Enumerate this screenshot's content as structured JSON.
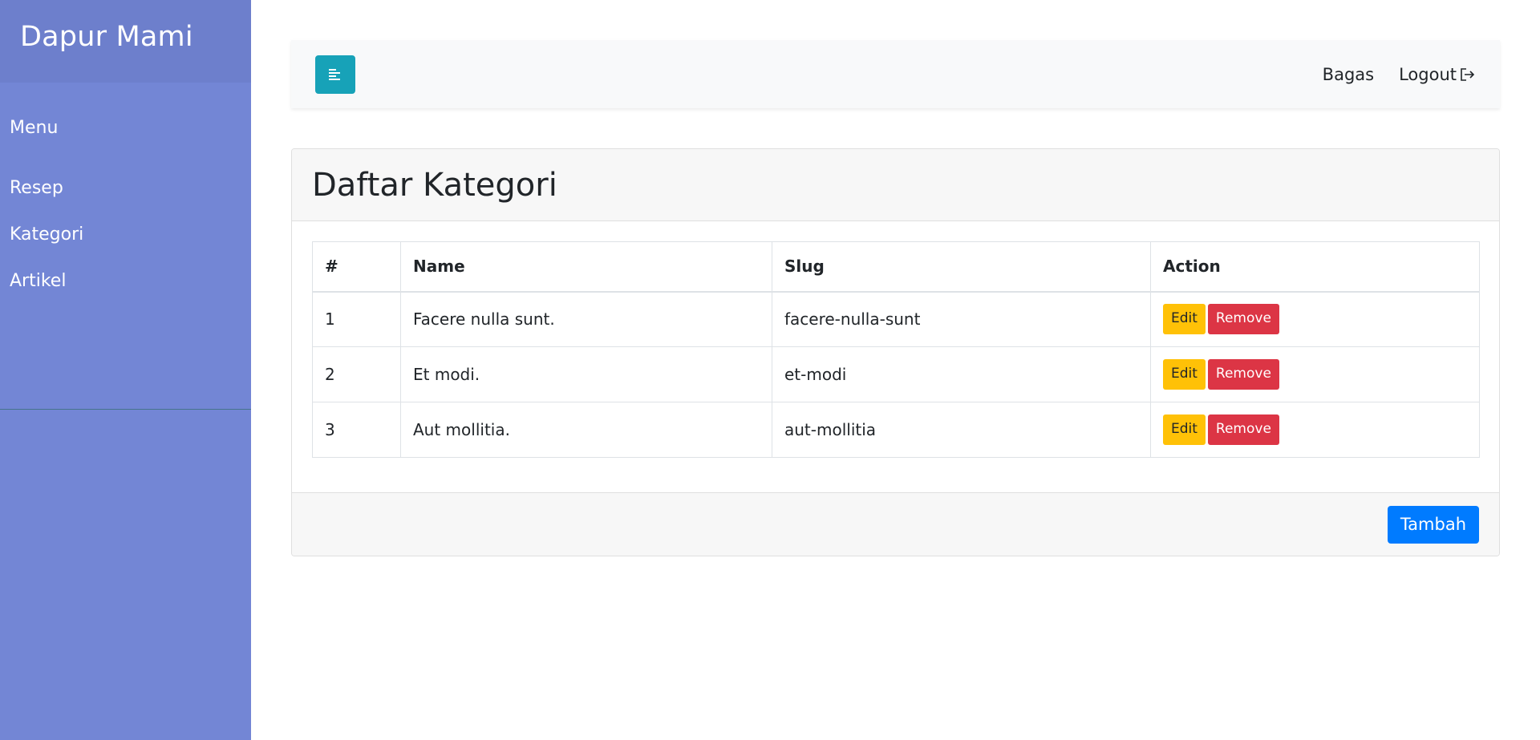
{
  "sidebar": {
    "brand": "Dapur Mami",
    "menu_heading": "Menu",
    "items": [
      {
        "label": "Resep"
      },
      {
        "label": "Kategori"
      },
      {
        "label": "Artikel"
      }
    ]
  },
  "topbar": {
    "toggle_icon": "align-left-icon",
    "user": "Bagas",
    "logout": "Logout",
    "logout_icon": "sign-out-icon"
  },
  "card": {
    "title": "Daftar Kategori",
    "columns": [
      "#",
      "Name",
      "Slug",
      "Action"
    ],
    "rows": [
      {
        "idx": "1",
        "name": "Facere nulla sunt.",
        "slug": "facere-nulla-sunt",
        "edit": "Edit",
        "remove": "Remove"
      },
      {
        "idx": "2",
        "name": "Et modi.",
        "slug": "et-modi",
        "edit": "Edit",
        "remove": "Remove"
      },
      {
        "idx": "3",
        "name": "Aut mollitia.",
        "slug": "aut-mollitia",
        "edit": "Edit",
        "remove": "Remove"
      }
    ],
    "add_button": "Tambah"
  },
  "colors": {
    "sidebar": "#7386d5",
    "sidebar_header": "#6d7fcc",
    "toggle": "#17a2b8",
    "edit": "#ffc107",
    "remove": "#dc3545",
    "primary": "#007bff"
  }
}
